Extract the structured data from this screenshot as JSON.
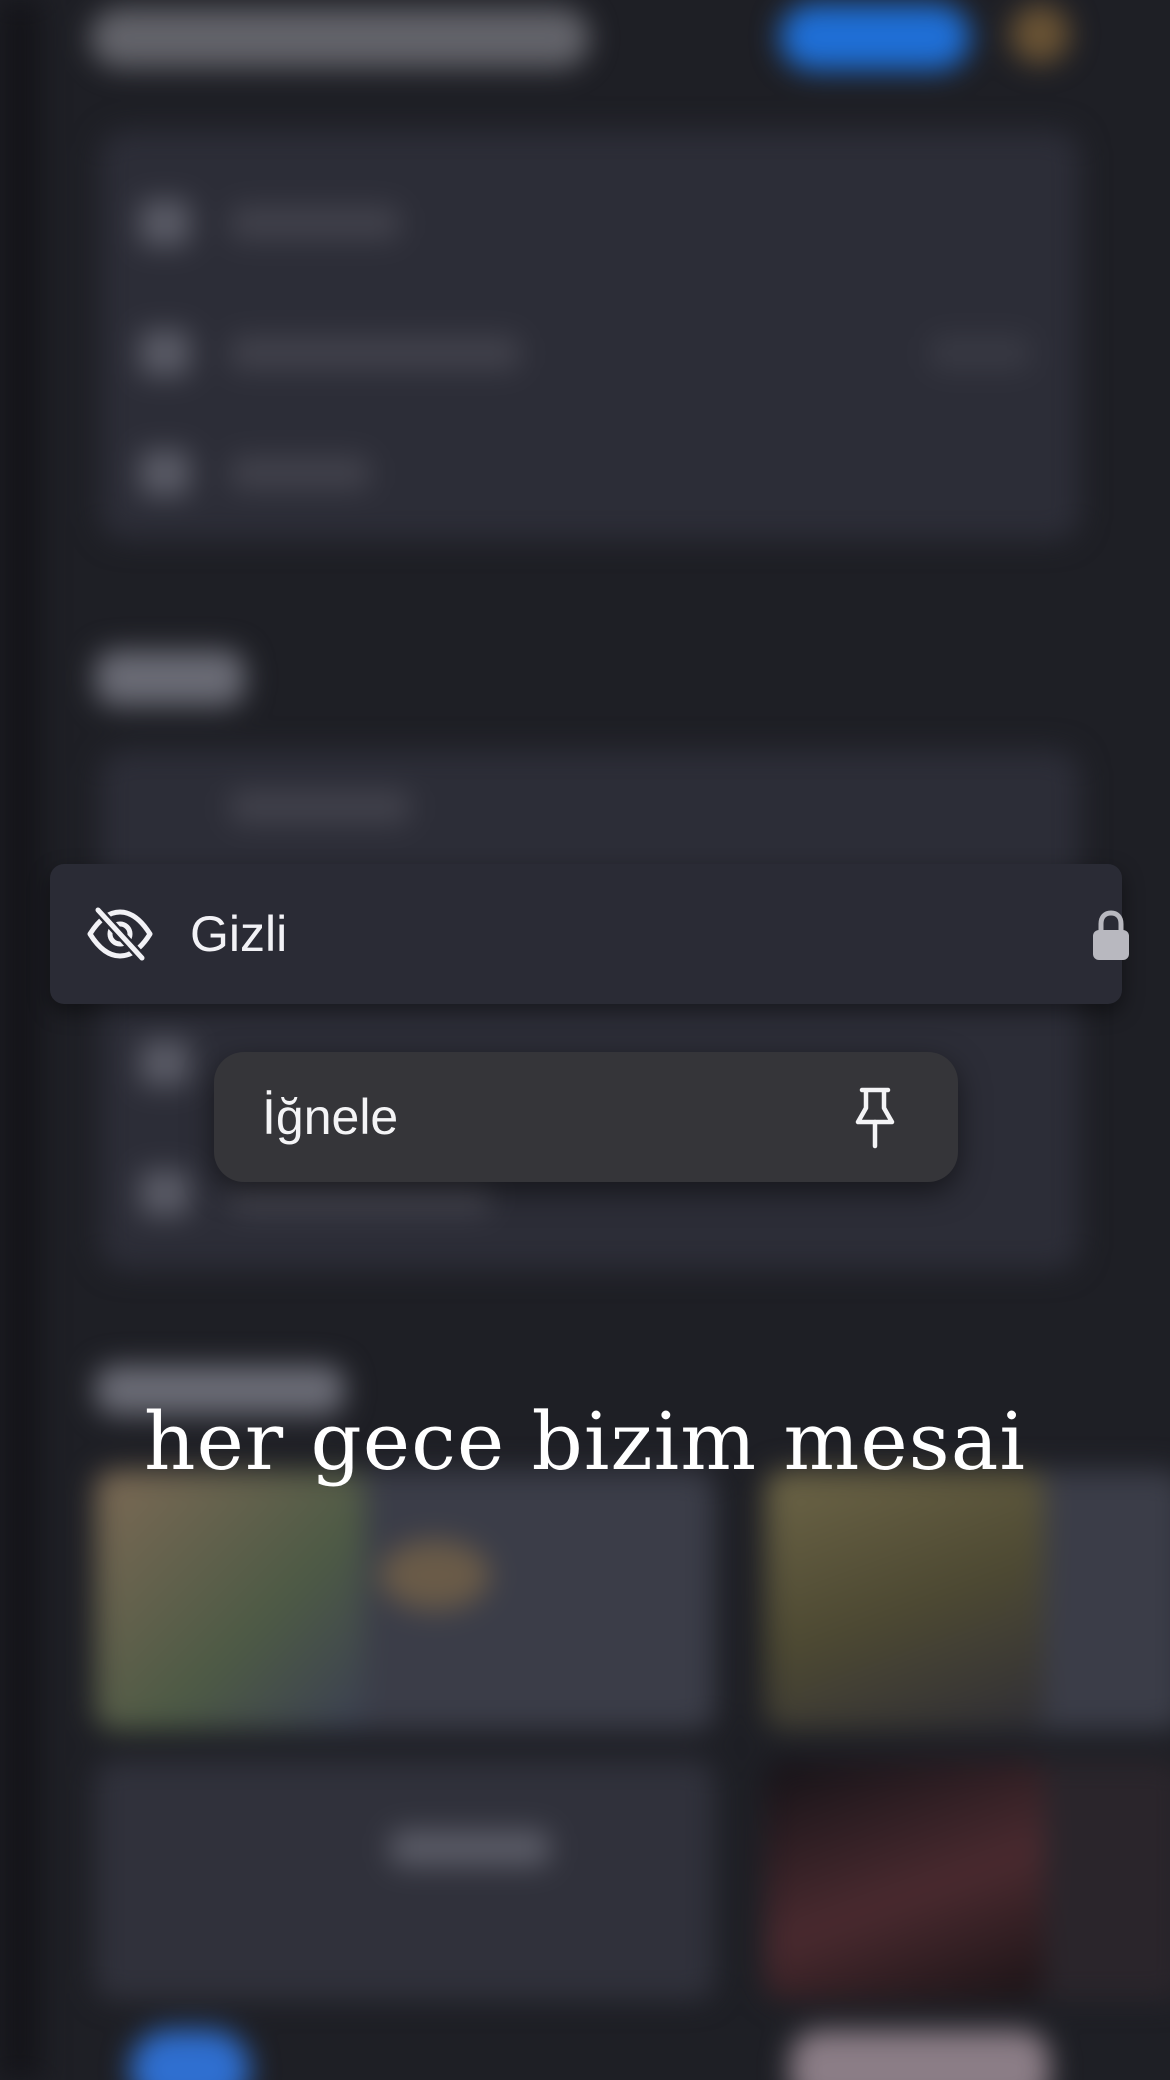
{
  "hidden_item": {
    "label": "Gizli",
    "icon": "eye-slash-icon",
    "trailing_icon": "lock-icon"
  },
  "context_menu": {
    "items": [
      {
        "label": "İğnele",
        "icon": "pin-icon"
      }
    ]
  },
  "caption": "her gece bizim mesai",
  "colors": {
    "background": "#1e1f25",
    "row_background": "#2a2b35",
    "menu_background": "#353539",
    "text": "#f2f2f6",
    "accent_blue": "#1f6fd6"
  }
}
